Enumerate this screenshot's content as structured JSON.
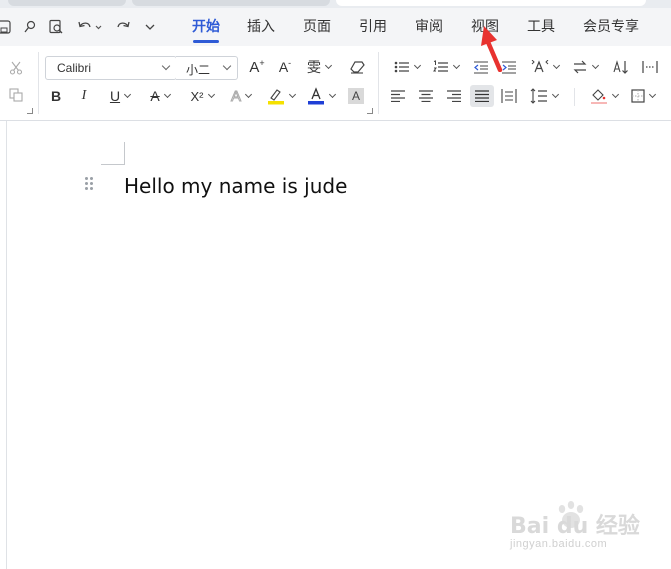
{
  "menu": {
    "tabs": [
      {
        "label": "开始",
        "active": true
      },
      {
        "label": "插入"
      },
      {
        "label": "页面"
      },
      {
        "label": "引用"
      },
      {
        "label": "审阅"
      },
      {
        "label": "视图"
      },
      {
        "label": "工具"
      },
      {
        "label": "会员专享"
      }
    ]
  },
  "ribbon": {
    "font_name": "Calibri",
    "font_size": "小二",
    "bold_label": "B",
    "italic_label": "I",
    "underline_label": "U",
    "strike_label": "A",
    "superscript_label": "X²",
    "text_effect_label": "A",
    "font_color_label": "A",
    "char_shade_label": "A",
    "grow_font_label": "A",
    "shrink_font_label": "A",
    "pinyin_label": "雯",
    "highlight_color": "#f5e100",
    "font_color": "#1f3fd6",
    "accent_color": "#2f5bd6"
  },
  "document": {
    "text": "Hello my name is jude"
  },
  "annotation": {
    "arrow_color": "#e8322f"
  },
  "watermark": {
    "logo": "Bai du 经验",
    "url": "jingyan.baidu.com"
  }
}
